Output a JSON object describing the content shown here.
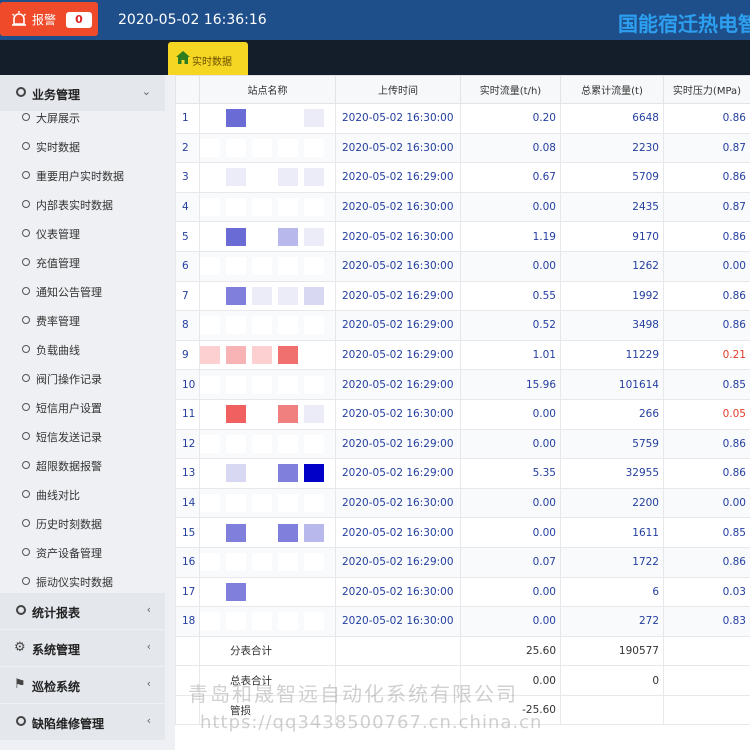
{
  "header": {
    "alarm_label": "报警",
    "alarm_count": "0",
    "datetime": "2020-05-02 16:36:16",
    "company_title": "国能宿迁热电智"
  },
  "tabs": [
    {
      "label": "实时数据"
    }
  ],
  "sidebar": {
    "groups": [
      {
        "label": "业务管理",
        "expanded": true
      },
      {
        "label": "统计报表"
      },
      {
        "label": "系统管理"
      },
      {
        "label": "巡检系统"
      },
      {
        "label": "缺陷维修管理"
      }
    ],
    "items": [
      {
        "label": "大屏展示"
      },
      {
        "label": "实时数据"
      },
      {
        "label": "重要用户实时数据"
      },
      {
        "label": "内部表实时数据"
      },
      {
        "label": "仪表管理"
      },
      {
        "label": "充值管理"
      },
      {
        "label": "通知公告管理"
      },
      {
        "label": "费率管理"
      },
      {
        "label": "负载曲线"
      },
      {
        "label": "阀门操作记录"
      },
      {
        "label": "短信用户设置"
      },
      {
        "label": "短信发送记录"
      },
      {
        "label": "超限数据报警"
      },
      {
        "label": "曲线对比"
      },
      {
        "label": "历史时刻数据"
      },
      {
        "label": "资产设备管理"
      },
      {
        "label": "振动仪实时数据"
      }
    ]
  },
  "table": {
    "columns": [
      "站点名称",
      "上传时间",
      "实时流量(t/h)",
      "总累计流量(t)",
      "实时压力(MPa)"
    ],
    "rows": [
      {
        "idx": "1",
        "time": "2020-05-02 16:30:00",
        "flow": "0.20",
        "total": "6648",
        "pressure": "0.86",
        "pressure_alarm": false
      },
      {
        "idx": "2",
        "time": "2020-05-02 16:30:00",
        "flow": "0.08",
        "total": "2230",
        "pressure": "0.87",
        "pressure_alarm": false
      },
      {
        "idx": "3",
        "time": "2020-05-02 16:29:00",
        "flow": "0.67",
        "total": "5709",
        "pressure": "0.86",
        "pressure_alarm": false
      },
      {
        "idx": "4",
        "time": "2020-05-02 16:30:00",
        "flow": "0.00",
        "total": "2435",
        "pressure": "0.87",
        "pressure_alarm": false
      },
      {
        "idx": "5",
        "time": "2020-05-02 16:30:00",
        "flow": "1.19",
        "total": "9170",
        "pressure": "0.86",
        "pressure_alarm": false
      },
      {
        "idx": "6",
        "time": "2020-05-02 16:30:00",
        "flow": "0.00",
        "total": "1262",
        "pressure": "0.00",
        "pressure_alarm": false
      },
      {
        "idx": "7",
        "time": "2020-05-02 16:29:00",
        "flow": "0.55",
        "total": "1992",
        "pressure": "0.86",
        "pressure_alarm": false
      },
      {
        "idx": "8",
        "time": "2020-05-02 16:29:00",
        "flow": "0.52",
        "total": "3498",
        "pressure": "0.86",
        "pressure_alarm": false
      },
      {
        "idx": "9",
        "time": "2020-05-02 16:29:00",
        "flow": "1.01",
        "total": "11229",
        "pressure": "0.21",
        "pressure_alarm": true
      },
      {
        "idx": "10",
        "time": "2020-05-02 16:29:00",
        "flow": "15.96",
        "total": "101614",
        "pressure": "0.85",
        "pressure_alarm": false
      },
      {
        "idx": "11",
        "time": "2020-05-02 16:30:00",
        "flow": "0.00",
        "total": "266",
        "pressure": "0.05",
        "pressure_alarm": true
      },
      {
        "idx": "12",
        "time": "2020-05-02 16:29:00",
        "flow": "0.00",
        "total": "5759",
        "pressure": "0.86",
        "pressure_alarm": false
      },
      {
        "idx": "13",
        "time": "2020-05-02 16:29:00",
        "flow": "5.35",
        "total": "32955",
        "pressure": "0.86",
        "pressure_alarm": false
      },
      {
        "idx": "14",
        "time": "2020-05-02 16:30:00",
        "flow": "0.00",
        "total": "2200",
        "pressure": "0.00",
        "pressure_alarm": false
      },
      {
        "idx": "15",
        "time": "2020-05-02 16:30:00",
        "flow": "0.00",
        "total": "1611",
        "pressure": "0.85",
        "pressure_alarm": false
      },
      {
        "idx": "16",
        "time": "2020-05-02 16:29:00",
        "flow": "0.07",
        "total": "1722",
        "pressure": "0.86",
        "pressure_alarm": false
      },
      {
        "idx": "17",
        "time": "2020-05-02 16:30:00",
        "flow": "0.00",
        "total": "6",
        "pressure": "0.03",
        "pressure_alarm": false
      },
      {
        "idx": "18",
        "time": "2020-05-02 16:30:00",
        "flow": "0.00",
        "total": "272",
        "pressure": "0.83",
        "pressure_alarm": false
      }
    ],
    "summary": [
      {
        "label": "分表合计",
        "flow": "25.60",
        "total": "190577"
      },
      {
        "label": "总表合计",
        "flow": "0.00",
        "total": "0"
      },
      {
        "label": "管损",
        "flow": "-25.60",
        "total": ""
      }
    ]
  },
  "watermark": {
    "line1": "青岛和晟智远自动化系统有限公司",
    "line2": "https://qq3438500767.cn.china.cn"
  },
  "colors": {
    "header_bg": "#1f4f8a",
    "alarm_bg": "#ef4a2a",
    "title_color": "#2d9ff0",
    "tab_active": "#f5d623",
    "alarm_value": "#e03c2a",
    "value_blue": "#2540a0"
  }
}
